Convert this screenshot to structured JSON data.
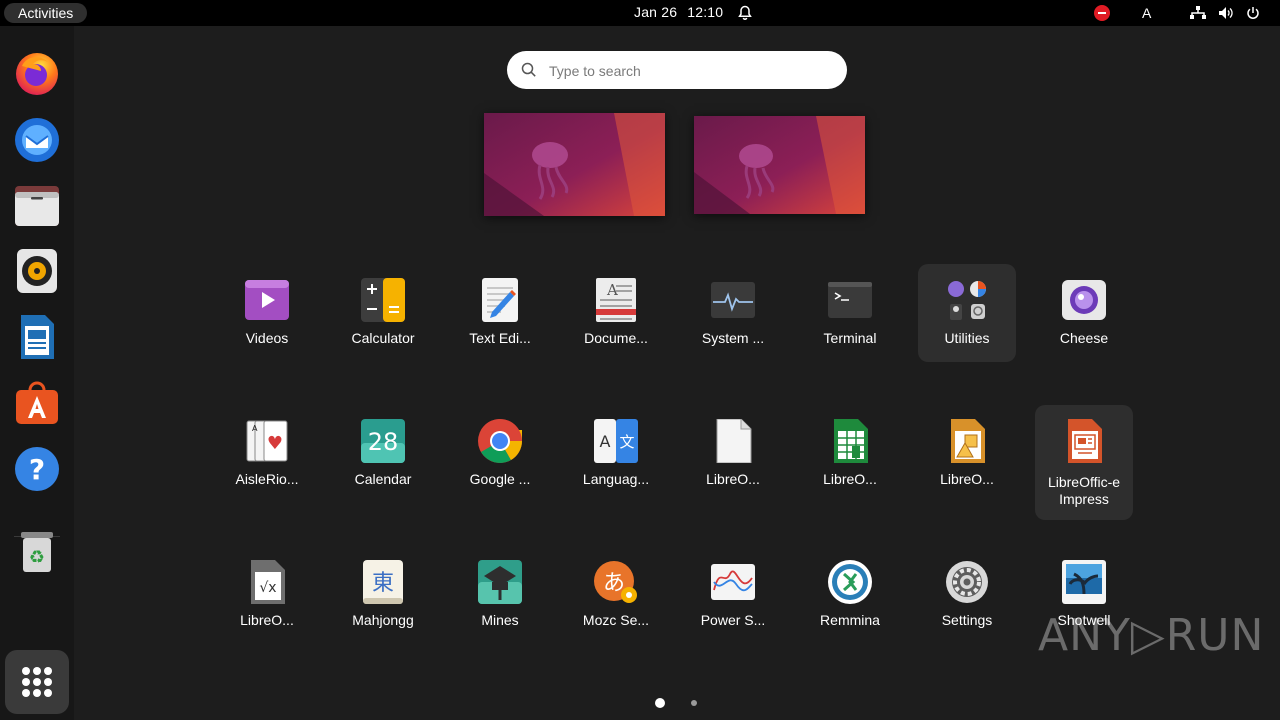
{
  "topbar": {
    "activities": "Activities",
    "date": "Jan 26",
    "time": "12:10",
    "input_source": "A",
    "icons": [
      "bell-icon",
      "do-not-disturb-icon",
      "network-icon",
      "volume-icon",
      "power-icon"
    ]
  },
  "dock": {
    "items": [
      "Firefox",
      "Thunderbird",
      "Files",
      "Rhythmbox",
      "LibreOffice Writer",
      "Ubuntu Software",
      "Help",
      "Trash",
      "Show Applications"
    ]
  },
  "search": {
    "placeholder": "Type to search",
    "value": ""
  },
  "apps": [
    {
      "label": "Videos",
      "icon": "videos-icon"
    },
    {
      "label": "Calculator",
      "icon": "calculator-icon"
    },
    {
      "label": "Text Edi...",
      "icon": "text-editor-icon"
    },
    {
      "label": "Docume...",
      "icon": "document-viewer-icon"
    },
    {
      "label": "System ...",
      "icon": "system-monitor-icon"
    },
    {
      "label": "Terminal",
      "icon": "terminal-icon"
    },
    {
      "label": "Utilities",
      "icon": "utilities-folder-icon"
    },
    {
      "label": "Cheese",
      "icon": "cheese-icon"
    },
    {
      "label": "AisleRio...",
      "icon": "aisleriot-icon"
    },
    {
      "label": "Calendar",
      "icon": "calendar-icon",
      "day": "28"
    },
    {
      "label": "Google ...",
      "icon": "chrome-icon"
    },
    {
      "label": "Languag...",
      "icon": "language-support-icon"
    },
    {
      "label": "LibreO...",
      "icon": "libreoffice-icon"
    },
    {
      "label": "LibreO...",
      "icon": "libreoffice-calc-icon"
    },
    {
      "label": "LibreO...",
      "icon": "libreoffice-draw-icon"
    },
    {
      "label": "LibreOffic-e Impress",
      "icon": "libreoffice-impress-icon"
    },
    {
      "label": "LibreO...",
      "icon": "libreoffice-math-icon"
    },
    {
      "label": "Mahjongg",
      "icon": "mahjongg-icon",
      "glyph": "東"
    },
    {
      "label": "Mines",
      "icon": "mines-icon"
    },
    {
      "label": "Mozc Se...",
      "icon": "mozc-icon",
      "glyph": "あ"
    },
    {
      "label": "Power S...",
      "icon": "power-statistics-icon"
    },
    {
      "label": "Remmina",
      "icon": "remmina-icon"
    },
    {
      "label": "Settings",
      "icon": "settings-icon"
    },
    {
      "label": "Shotwell",
      "icon": "shotwell-icon"
    }
  ],
  "pagination": {
    "pages": 2,
    "current": 1
  },
  "watermark": "ANY▷RUN",
  "colors": {
    "accent_orange": "#e95420",
    "topbar": "#000000",
    "dock": "#171717",
    "overview_bg": "#1d1d1d"
  }
}
